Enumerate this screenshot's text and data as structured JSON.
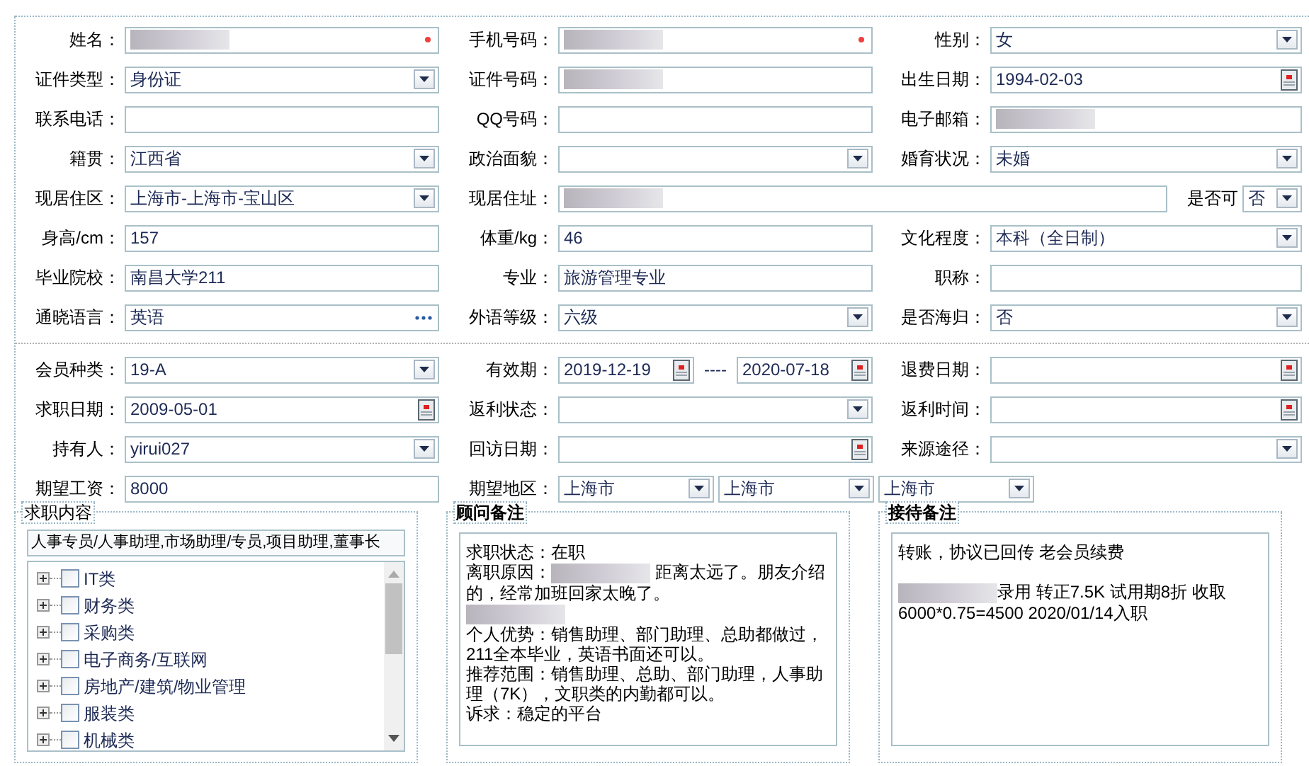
{
  "sections": [
    {
      "rows": [
        {
          "cells": [
            {
              "label": "姓名：",
              "controls": [
                {
                  "kind": "text",
                  "redacted": true,
                  "required": true
                }
              ]
            },
            {
              "label": "手机号码：",
              "controls": [
                {
                  "kind": "text",
                  "redacted": true,
                  "required": true
                }
              ]
            },
            {
              "label": "性别：",
              "controls": [
                {
                  "kind": "select",
                  "value": "女"
                }
              ]
            }
          ]
        },
        {
          "cells": [
            {
              "label": "证件类型：",
              "controls": [
                {
                  "kind": "select",
                  "value": "身份证"
                }
              ]
            },
            {
              "label": "证件号码：",
              "controls": [
                {
                  "kind": "text",
                  "redacted": true
                }
              ]
            },
            {
              "label": "出生日期：",
              "controls": [
                {
                  "kind": "date",
                  "value": "1994-02-03"
                }
              ]
            }
          ]
        },
        {
          "cells": [
            {
              "label": "联系电话：",
              "controls": [
                {
                  "kind": "text"
                }
              ]
            },
            {
              "label": "QQ号码：",
              "controls": [
                {
                  "kind": "text"
                }
              ]
            },
            {
              "label": "电子邮箱：",
              "controls": [
                {
                  "kind": "text",
                  "redacted": true
                }
              ]
            }
          ]
        },
        {
          "cells": [
            {
              "label": "籍贯：",
              "controls": [
                {
                  "kind": "select",
                  "value": "江西省"
                }
              ]
            },
            {
              "label": "政治面貌：",
              "controls": [
                {
                  "kind": "select"
                }
              ]
            },
            {
              "label": "婚育状况：",
              "controls": [
                {
                  "kind": "select",
                  "value": "未婚"
                }
              ]
            }
          ]
        },
        {
          "cells": [
            {
              "label": "现居住区：",
              "controls": [
                {
                  "kind": "select",
                  "value": "上海市-上海市-宝山区"
                }
              ]
            },
            {
              "label": "现居住址：",
              "controls": [
                {
                  "kind": "text",
                  "redacted": true
                },
                {
                  "kind": "inline_label",
                  "text": "是否可"
                },
                {
                  "kind": "select",
                  "value": "否"
                }
              ]
            }
          ]
        },
        {
          "cells": [
            {
              "label": "身高/cm：",
              "controls": [
                {
                  "kind": "text",
                  "value": "157"
                }
              ]
            },
            {
              "label": "体重/kg：",
              "controls": [
                {
                  "kind": "text",
                  "value": "46"
                }
              ]
            },
            {
              "label": "文化程度：",
              "controls": [
                {
                  "kind": "select",
                  "value": "本科（全日制）"
                }
              ]
            }
          ]
        },
        {
          "cells": [
            {
              "label": "毕业院校：",
              "controls": [
                {
                  "kind": "text",
                  "value": "南昌大学211"
                }
              ]
            },
            {
              "label": "专业：",
              "controls": [
                {
                  "kind": "text",
                  "value": "旅游管理专业"
                }
              ]
            },
            {
              "label": "职称：",
              "controls": [
                {
                  "kind": "text"
                }
              ]
            }
          ]
        },
        {
          "cells": [
            {
              "label": "通晓语言：",
              "controls": [
                {
                  "kind": "lookup",
                  "value": "英语"
                }
              ]
            },
            {
              "label": "外语等级：",
              "controls": [
                {
                  "kind": "select",
                  "value": "六级"
                }
              ]
            },
            {
              "label": "是否海归：",
              "controls": [
                {
                  "kind": "select",
                  "value": "否"
                }
              ]
            }
          ]
        }
      ]
    },
    {
      "rows": [
        {
          "cells": [
            {
              "label": "会员种类：",
              "controls": [
                {
                  "kind": "select",
                  "value": "19-A"
                }
              ]
            },
            {
              "label": "有效期：",
              "controls": [
                {
                  "kind": "date",
                  "value": "2019-12-19"
                },
                {
                  "kind": "separator",
                  "text": "----"
                },
                {
                  "kind": "date",
                  "value": "2020-07-18"
                }
              ]
            },
            {
              "label": "退费日期：",
              "controls": [
                {
                  "kind": "date"
                }
              ]
            }
          ]
        },
        {
          "cells": [
            {
              "label": "求职日期：",
              "controls": [
                {
                  "kind": "date",
                  "value": "2009-05-01"
                }
              ]
            },
            {
              "label": "返利状态：",
              "controls": [
                {
                  "kind": "select"
                }
              ]
            },
            {
              "label": "返利时间：",
              "controls": [
                {
                  "kind": "date"
                }
              ]
            }
          ]
        },
        {
          "cells": [
            {
              "label": "持有人：",
              "controls": [
                {
                  "kind": "select",
                  "value": "yirui027"
                }
              ]
            },
            {
              "label": "回访日期：",
              "controls": [
                {
                  "kind": "date"
                }
              ]
            },
            {
              "label": "来源途径：",
              "controls": [
                {
                  "kind": "select"
                }
              ]
            }
          ]
        },
        {
          "cells": [
            {
              "label": "期望工资：",
              "controls": [
                {
                  "kind": "text",
                  "value": "8000"
                }
              ]
            },
            {
              "label": "期望地区：",
              "controls": [
                {
                  "kind": "select",
                  "value": "上海市"
                },
                {
                  "kind": "select",
                  "value": "上海市"
                },
                {
                  "kind": "select",
                  "value": "上海市"
                }
              ]
            }
          ]
        }
      ]
    }
  ],
  "panels": [
    {
      "kind": "tree",
      "legend": "求职内容",
      "value": "人事专员/人事助理,市场助理/专员,项目助理,董事长",
      "items": [
        {
          "label": "IT类",
          "checked": false,
          "expanded": false
        },
        {
          "label": "财务类",
          "checked": false,
          "expanded": false
        },
        {
          "label": "采购类",
          "checked": false,
          "expanded": false
        },
        {
          "label": "电子商务/互联网",
          "checked": false,
          "expanded": false
        },
        {
          "label": "房地产/建筑/物业管理",
          "checked": false,
          "expanded": false
        },
        {
          "label": "服装类",
          "checked": false,
          "expanded": false
        },
        {
          "label": "机械类",
          "checked": false,
          "expanded": false
        }
      ]
    },
    {
      "kind": "note",
      "legend": "顾问备注",
      "lines": [
        [
          {
            "kind": "text",
            "text": "求职状态：在职"
          }
        ],
        [
          {
            "kind": "text",
            "text": "离职原因："
          },
          {
            "kind": "redacted"
          },
          {
            "kind": "text",
            "text": " 距离太远了。朋友介绍的，经常加班回家太晚了。"
          }
        ],
        [
          {
            "kind": "redacted"
          }
        ],
        [
          {
            "kind": "text",
            "text": "个人优势：销售助理、部门助理、总助都做过，211全本毕业，英语书面还可以。"
          }
        ],
        [
          {
            "kind": "text",
            "text": "推荐范围：销售助理、总助、部门助理，人事助理（7K），文职类的内勤都可以。"
          }
        ],
        [
          {
            "kind": "text",
            "text": "诉求：稳定的平台"
          }
        ]
      ]
    },
    {
      "kind": "note",
      "legend": "接待备注",
      "lines": [
        [
          {
            "kind": "text",
            "text": "转账，协议已回传 老会员续费"
          }
        ],
        [
          {
            "kind": "blank"
          }
        ],
        [
          {
            "kind": "redacted"
          },
          {
            "kind": "text",
            "text": "录用 转正7.5K 试用期8折 收取6000*0.75=4500 2020/01/14入职"
          }
        ]
      ]
    }
  ]
}
